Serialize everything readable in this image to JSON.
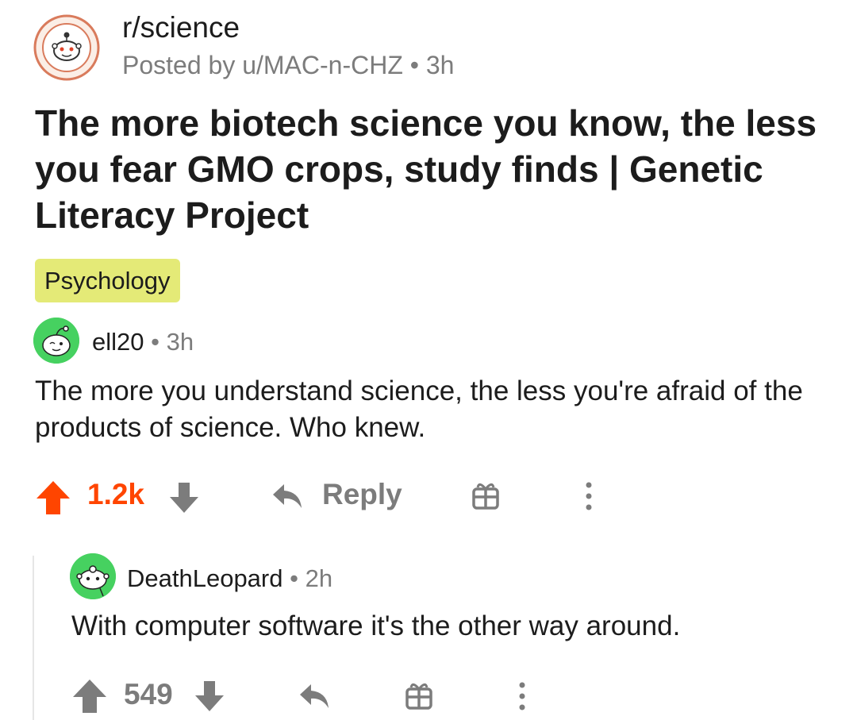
{
  "post": {
    "subreddit": "r/science",
    "posted_by": "Posted by u/MAC-n-CHZ • 3h",
    "title": "The more biotech science you know, the less you fear GMO crops, study finds | Genetic Literacy Project",
    "flair": "Psychology",
    "subreddit_icon": "science-subreddit-seal-icon",
    "flair_color": "#e4ea77"
  },
  "comments": [
    {
      "author": "ell20",
      "separator": "•",
      "time": "3h",
      "body": "The more you understand science, the less you're afraid of the products of science. Who knew.",
      "score": "1.2k",
      "score_color": "#ff4500",
      "upvote_icon": "upvote-arrow-icon",
      "upvote_color": "#ff4500",
      "reply_label": "Reply",
      "avatar_icon": "snoo-avatar-icon",
      "avatar_color": "#46d160"
    },
    {
      "author": "DeathLeopard",
      "separator": "•",
      "time": "2h",
      "body": "With computer software it's the other way around.",
      "score": "549",
      "score_color": "#7c7c7c",
      "upvote_icon": "upvote-arrow-icon",
      "upvote_color": "#7c7c7c",
      "avatar_icon": "snoo-avatar-icon",
      "avatar_color": "#46d160"
    }
  ],
  "icons": {
    "downvote": "downvote-arrow-icon",
    "reply": "reply-arrow-icon",
    "award": "gift-award-icon",
    "more": "more-options-icon"
  },
  "colors": {
    "meta_gray": "#7c7c7c",
    "text": "#1c1c1c",
    "upvoted": "#ff4500"
  }
}
